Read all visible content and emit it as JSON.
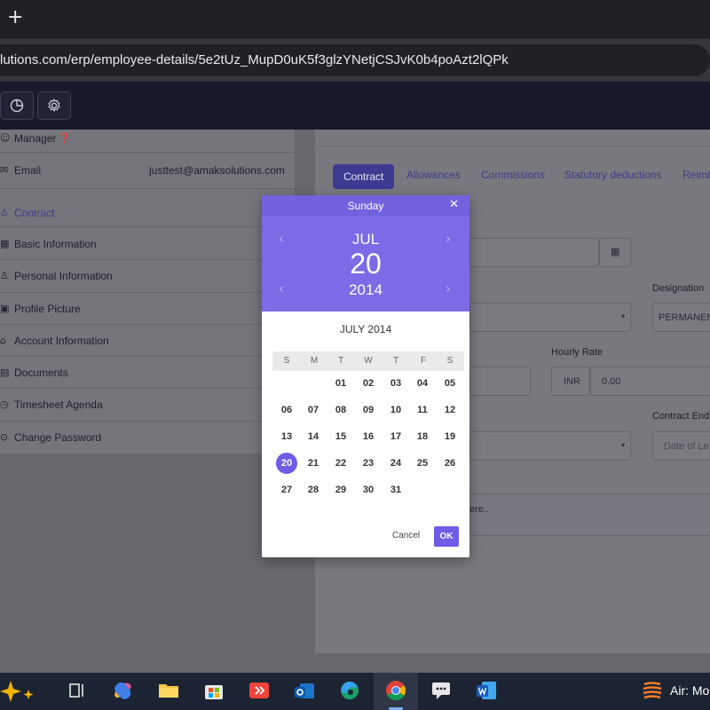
{
  "browser": {
    "new_tab_symbol": "+",
    "url": "lutions.com/erp/employee-details/5e2tUz_MupD0uK5f3glzYNetjCSJvK0b4poAzt2lQPk"
  },
  "profile": {
    "manager_label": "Manager",
    "email_label": "Email",
    "email_value": "justtest@amaksolutions.com",
    "menu": [
      {
        "label": "Contract",
        "icon": "user-icon"
      },
      {
        "label": "Basic Information",
        "icon": "calendar-icon"
      },
      {
        "label": "Personal Information",
        "icon": "user-icon"
      },
      {
        "label": "Profile Picture",
        "icon": "image-icon"
      },
      {
        "label": "Account Information",
        "icon": "bank-icon"
      },
      {
        "label": "Documents",
        "icon": "document-icon"
      },
      {
        "label": "Timesheet Agenda",
        "icon": "clock-icon"
      },
      {
        "label": "Change Password",
        "icon": "lock-icon"
      }
    ]
  },
  "tabs": [
    "Contract",
    "Allowances",
    "Commissions",
    "Statutory deductions",
    "Reimb"
  ],
  "form": {
    "designation_label": "Designation",
    "designation_value": "PERMANEN",
    "hourly_rate_label": "Hourly Rate",
    "currency": "INR",
    "hourly_rate_value": "0.00",
    "contract_end_label": "Contract End",
    "contract_end_placeholder": "Date of Le",
    "notes_placeholder_fragment": "ere.."
  },
  "datepicker": {
    "weekday": "Sunday",
    "month": "JUL",
    "day": "20",
    "year": "2014",
    "title": "JULY 2014",
    "dow": [
      "S",
      "M",
      "T",
      "W",
      "T",
      "F",
      "S"
    ],
    "weeks": [
      [
        "",
        "",
        "01",
        "02",
        "03",
        "04",
        "05"
      ],
      [
        "06",
        "07",
        "08",
        "09",
        "10",
        "11",
        "12"
      ],
      [
        "13",
        "14",
        "15",
        "16",
        "17",
        "18",
        "19"
      ],
      [
        "20",
        "21",
        "22",
        "23",
        "24",
        "25",
        "26"
      ],
      [
        "27",
        "28",
        "29",
        "30",
        "31",
        "",
        ""
      ]
    ],
    "selected": "20",
    "cancel_label": "Cancel",
    "ok_label": "OK",
    "accent": "#7b6be7"
  },
  "taskbar": {
    "weather_text": "Air: Mo"
  }
}
